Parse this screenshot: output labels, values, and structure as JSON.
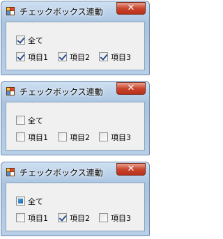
{
  "windows": [
    {
      "title": "チェックボックス連動",
      "close_glyph": "✕",
      "all": {
        "label": "全て",
        "state": "checked"
      },
      "items": [
        {
          "label": "項目1",
          "state": "checked"
        },
        {
          "label": "項目2",
          "state": "checked"
        },
        {
          "label": "項目3",
          "state": "checked"
        }
      ]
    },
    {
      "title": "チェックボックス連動",
      "close_glyph": "✕",
      "all": {
        "label": "全て",
        "state": "unchecked"
      },
      "items": [
        {
          "label": "項目1",
          "state": "unchecked"
        },
        {
          "label": "項目2",
          "state": "unchecked"
        },
        {
          "label": "項目3",
          "state": "unchecked"
        }
      ]
    },
    {
      "title": "チェックボックス連動",
      "close_glyph": "✕",
      "all": {
        "label": "全て",
        "state": "indeterminate"
      },
      "items": [
        {
          "label": "項目1",
          "state": "unchecked"
        },
        {
          "label": "項目2",
          "state": "checked"
        },
        {
          "label": "項目3",
          "state": "unchecked"
        }
      ]
    }
  ]
}
